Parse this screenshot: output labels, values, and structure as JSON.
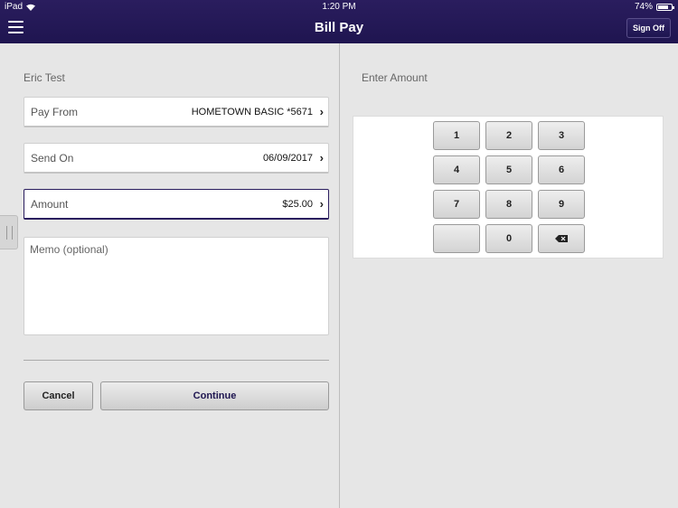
{
  "status_bar": {
    "device": "iPad",
    "time": "1:20 PM",
    "battery": "74%"
  },
  "nav": {
    "title": "Bill Pay",
    "sign_off": "Sign Off"
  },
  "form": {
    "user_name": "Eric Test",
    "pay_from": {
      "label": "Pay From",
      "value": "HOMETOWN BASIC *5671"
    },
    "send_on": {
      "label": "Send On",
      "value": "06/09/2017"
    },
    "amount": {
      "label": "Amount",
      "value": "$25.00"
    },
    "memo_placeholder": "Memo (optional)",
    "cancel_label": "Cancel",
    "continue_label": "Continue"
  },
  "keypad": {
    "title": "Enter Amount",
    "keys": [
      "1",
      "2",
      "3",
      "4",
      "5",
      "6",
      "7",
      "8",
      "9",
      "",
      "0",
      "backspace-icon"
    ]
  }
}
